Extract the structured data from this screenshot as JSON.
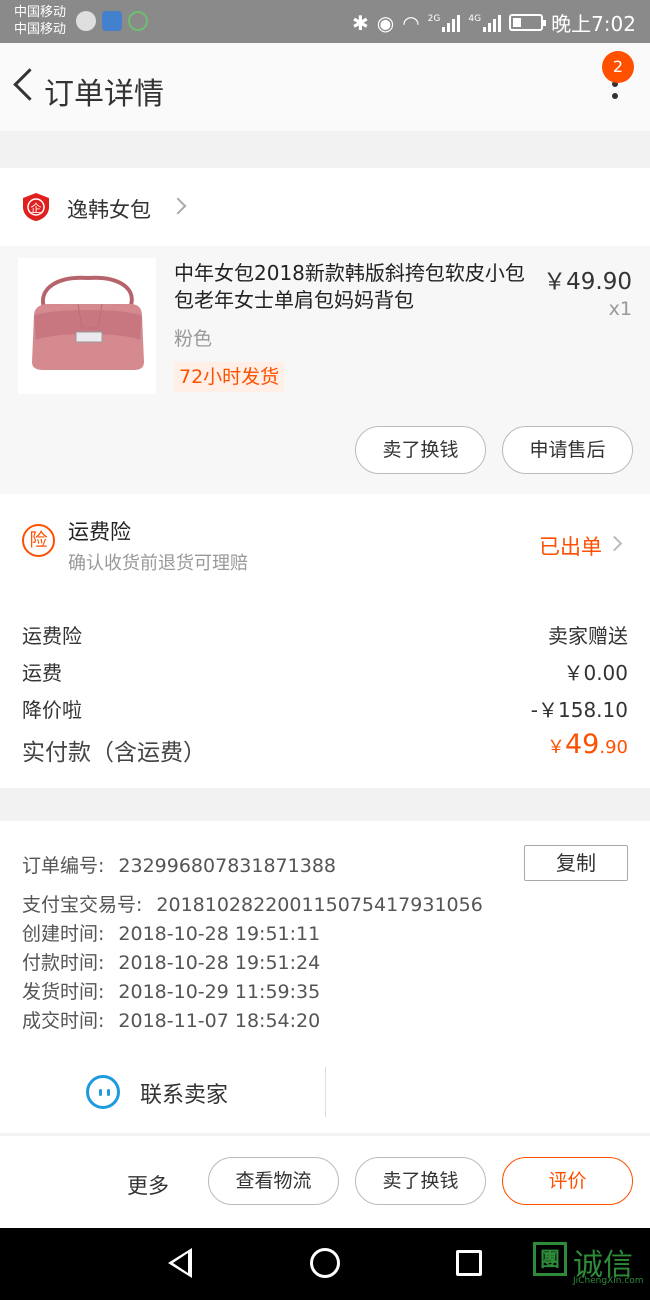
{
  "status_bar": {
    "carrier_1": "中国移动",
    "carrier_2": "中国移动",
    "network_1": "2G",
    "network_2": "4G",
    "time": "晚上7:02"
  },
  "header": {
    "title": "订单详情",
    "notification_count": "2"
  },
  "shop": {
    "icon_text": "企",
    "name": "逸韩女包"
  },
  "product": {
    "title": "中年女包2018新款韩版斜挎包软皮小包包老年女士单肩包妈妈背包",
    "price": "￥49.90",
    "quantity": "x1",
    "sku": "粉色",
    "shipping_tag": "72小时发货",
    "buttons": [
      "卖了换钱",
      "申请售后"
    ]
  },
  "insurance": {
    "icon_text": "险",
    "title": "运费险",
    "description": "确认收货前退货可理赔",
    "status": "已出单"
  },
  "fees": [
    {
      "label": "运费险",
      "value": "卖家赠送"
    },
    {
      "label": "运费",
      "value": "￥0.00"
    },
    {
      "label": "降价啦",
      "value": "-￥158.10"
    }
  ],
  "total": {
    "label": "实付款（含运费）",
    "currency": "￥",
    "integer": "49",
    "decimal": ".90"
  },
  "order_info": [
    {
      "label": "订单编号:",
      "value": "232996807831871388"
    },
    {
      "label": "支付宝交易号:",
      "value": "2018102822001150754179310 56"
    },
    {
      "label": "创建时间:",
      "value": "2018-10-28 19:51:11"
    },
    {
      "label": "付款时间:",
      "value": "2018-10-28 19:51:24"
    },
    {
      "label": "发货时间:",
      "value": "2018-10-29 11:59:35"
    },
    {
      "label": "成交时间:",
      "value": "2018-11-07 18:54:20"
    }
  ],
  "copy_label": "复制",
  "contact_label": "联系卖家",
  "actions": {
    "more": "更多",
    "logistics": "查看物流",
    "sell": "卖了换钱",
    "review": "评价"
  },
  "watermark": {
    "icon_text": "團",
    "text": "诚信",
    "sub": "JiChengXin.com"
  },
  "colors": {
    "accent": "#ff5000",
    "contact_blue": "#1e9bde",
    "status_bar": "#8a8a8a"
  }
}
